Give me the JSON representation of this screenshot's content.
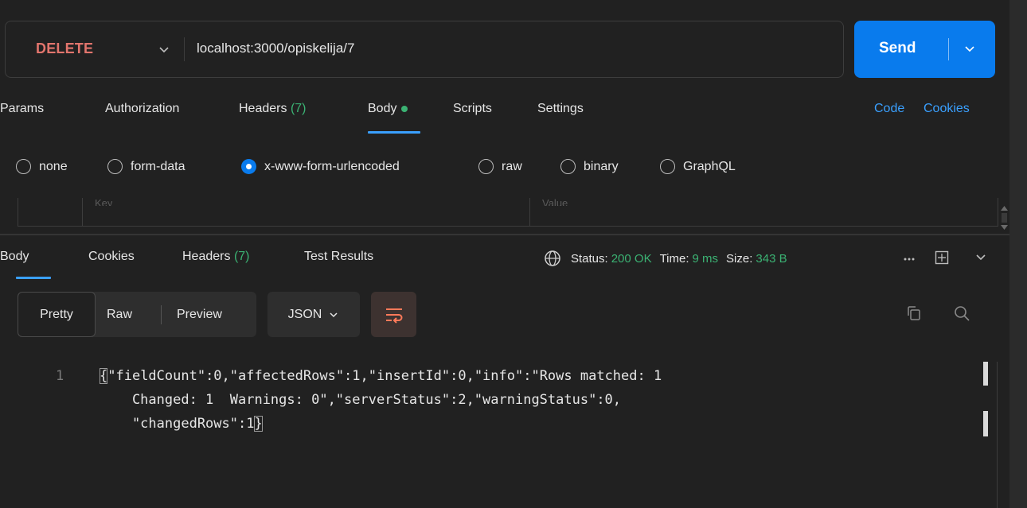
{
  "request": {
    "method": "DELETE",
    "url": "localhost:3000/opiskelija/7",
    "send_label": "Send"
  },
  "request_tabs": [
    {
      "label": "Params"
    },
    {
      "label": "Authorization"
    },
    {
      "label": "Headers",
      "count": "(7)"
    },
    {
      "label": "Body",
      "active": true
    },
    {
      "label": "Scripts"
    },
    {
      "label": "Settings"
    }
  ],
  "request_links": {
    "code": "Code",
    "cookies": "Cookies"
  },
  "body_types": [
    {
      "label": "none",
      "checked": false
    },
    {
      "label": "form-data",
      "checked": false
    },
    {
      "label": "x-www-form-urlencoded",
      "checked": true
    },
    {
      "label": "raw",
      "checked": false
    },
    {
      "label": "binary",
      "checked": false
    },
    {
      "label": "GraphQL",
      "checked": false
    }
  ],
  "kv_table": {
    "key_placeholder": "Key",
    "value_placeholder": "Value"
  },
  "response_tabs": [
    {
      "label": "Body",
      "active": true
    },
    {
      "label": "Cookies"
    },
    {
      "label": "Headers",
      "count": "(7)"
    },
    {
      "label": "Test Results"
    }
  ],
  "response_status": {
    "status_label": "Status:",
    "status_value": "200 OK",
    "time_label": "Time:",
    "time_value": "9 ms",
    "size_label": "Size:",
    "size_value": "343 B"
  },
  "view_modes": {
    "pretty": "Pretty",
    "raw": "Raw",
    "preview": "Preview"
  },
  "format": "JSON",
  "code": {
    "line_numbers": [
      "1"
    ],
    "lines": [
      "{\"fieldCount\":0,\"affectedRows\":1,\"insertId\":0,\"info\":\"Rows matched: 1",
      "    Changed: 1  Warnings: 0\",\"serverStatus\":2,\"warningStatus\":0,",
      "    \"changedRows\":1}"
    ]
  },
  "colors": {
    "accent": "#097bed",
    "method_delete": "#e2756d",
    "success": "#3bb273",
    "link": "#3aa0ff",
    "background": "#212121"
  },
  "icons": [
    "chevron-down-icon",
    "globe-icon",
    "more-icon",
    "save-response-icon",
    "wrap-lines-icon",
    "copy-icon",
    "search-icon"
  ]
}
